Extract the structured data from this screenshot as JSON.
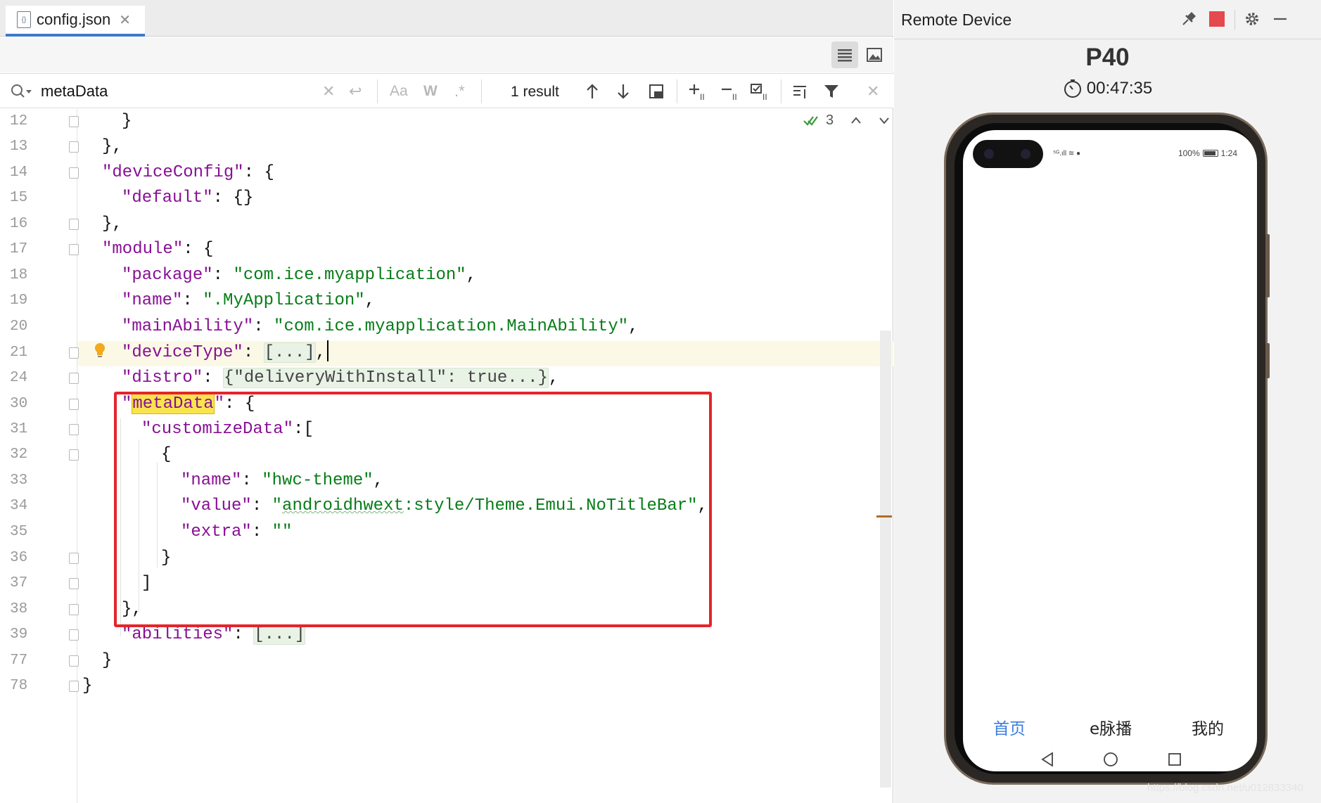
{
  "editor": {
    "tab": {
      "label": "config.json",
      "icon": "json-file-icon"
    },
    "search": {
      "query": "metaData",
      "result_label": "1 result"
    },
    "inspections_count": "3",
    "lines": [
      {
        "num": "12",
        "text": "}"
      },
      {
        "num": "13",
        "text": "},"
      },
      {
        "num": "14",
        "key": "\"deviceConfig\"",
        "rest": ": {"
      },
      {
        "num": "15",
        "key": "\"default\"",
        "rest": ": {}"
      },
      {
        "num": "16",
        "text": "},"
      },
      {
        "num": "17",
        "key": "\"module\"",
        "rest": ": {"
      },
      {
        "num": "18",
        "key": "\"package\"",
        "sep": ": ",
        "value": "\"com.ice.myapplication\"",
        "end": ","
      },
      {
        "num": "19",
        "key": "\"name\"",
        "sep": ": ",
        "value": "\".MyApplication\"",
        "end": ","
      },
      {
        "num": "20",
        "key": "\"mainAbility\"",
        "sep": ": ",
        "value": "\"com.ice.myapplication.MainAbility\"",
        "end": ","
      },
      {
        "num": "21",
        "key": "\"deviceType\"",
        "sep": ": ",
        "fold": "[...]",
        "end": ","
      },
      {
        "num": "24",
        "key": "\"distro\"",
        "sep": ": ",
        "fold": "{\"deliveryWithInstall\": true...}",
        "end": ","
      },
      {
        "num": "30",
        "key_open": "\"",
        "key_hl": "metaData",
        "key_close": "\"",
        "rest": ": {"
      },
      {
        "num": "31",
        "key": "\"customizeData\"",
        "rest": ":["
      },
      {
        "num": "32",
        "text": "{"
      },
      {
        "num": "33",
        "key": "\"name\"",
        "sep": ": ",
        "value": "\"hwc-theme\"",
        "end": ","
      },
      {
        "num": "34",
        "key": "\"value\"",
        "sep": ": ",
        "value_q": "\"",
        "value_wave": "androidhwext",
        "value_rest": ":style/Theme.Emui.NoTitleBar\"",
        "end": ","
      },
      {
        "num": "35",
        "key": "\"extra\"",
        "sep": ": ",
        "value": "\"\""
      },
      {
        "num": "36",
        "text": "}"
      },
      {
        "num": "37",
        "text": "]"
      },
      {
        "num": "38",
        "text": "},"
      },
      {
        "num": "39",
        "key": "\"abilities\"",
        "sep": ": ",
        "fold": "[...]"
      },
      {
        "num": "77",
        "text": "}"
      },
      {
        "num": "78",
        "text": "}"
      }
    ]
  },
  "device": {
    "panel_title": "Remote Device",
    "name": "P40",
    "timer": "00:47:35",
    "status_left": "⁵ᴳ.ıll ≋ ●",
    "battery_text": "100%",
    "time": "1:24",
    "nav_tabs": [
      "首页",
      "e脉播",
      "我的"
    ],
    "active_tab_color": "#3a7ce0",
    "recording_color": "#e5484d"
  },
  "watermark": "https://blog.csdn.net/u012833340"
}
